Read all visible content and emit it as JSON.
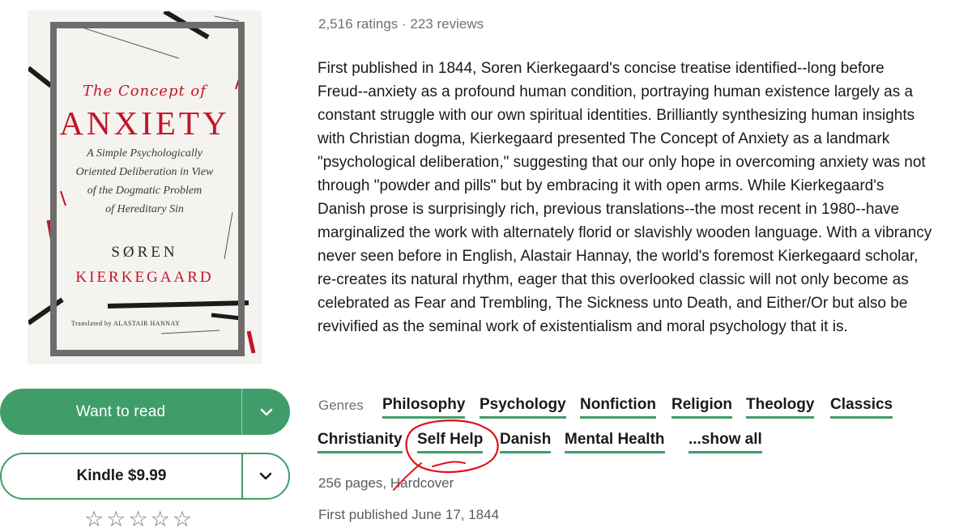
{
  "book": {
    "cover": {
      "pretitle": "The Concept of",
      "title": "ANXIETY",
      "subtitle_lines": [
        "A Simple Psychologically",
        "Oriented Deliberation in View",
        "of the Dogmatic Problem",
        "of Hereditary Sin"
      ],
      "author_first": "SØREN",
      "author_last": "KIERKEGAARD",
      "translator": "Translated by ALASTAIR HANNAY"
    },
    "ratings_text": "2,516 ratings · 223 reviews",
    "description": "First published in 1844, Soren Kierkegaard's concise treatise identified--long before Freud--anxiety as a profound human condition, portraying human existence largely as a constant struggle with our own spiritual identities. Brilliantly synthesizing human insights with Christian dogma, Kierkegaard presented The Concept of Anxiety as a landmark \"psychological deliberation,\" suggesting that our only hope in overcoming anxiety was not through \"powder and pills\" but by embracing it with open arms. While Kierkegaard's Danish prose is surprisingly rich, previous translations--the most recent in 1980--have marginalized the work with alternately florid or slavishly wooden language. With a vibrancy never seen before in English, Alastair Hannay, the world's foremost Kierkegaard scholar, re-creates its natural rhythm, eager that this overlooked classic will not only become as celebrated as Fear and Trembling, The Sickness unto Death, and Either/Or but also be revivified as the seminal work of existentialism and moral psychology that it is.",
    "genres_label": "Genres",
    "genres": [
      "Philosophy",
      "Psychology",
      "Nonfiction",
      "Religion",
      "Theology",
      "Classics",
      "Christianity",
      "Self Help",
      "Danish",
      "Mental Health",
      "...show all"
    ],
    "pages_format": "256 pages, Hardcover",
    "first_published": "First published June 17, 1844"
  },
  "actions": {
    "want_to_read": "Want to read",
    "kindle": "Kindle $9.99",
    "stars": [
      "☆",
      "☆",
      "☆",
      "☆",
      "☆"
    ]
  },
  "colors": {
    "accent_green": "#409d69",
    "cover_red": "#c2152b",
    "annotation_red": "#e0101a"
  },
  "icons": {
    "dropdown": "chevron-down-icon",
    "rating": "star-outline-icon"
  }
}
